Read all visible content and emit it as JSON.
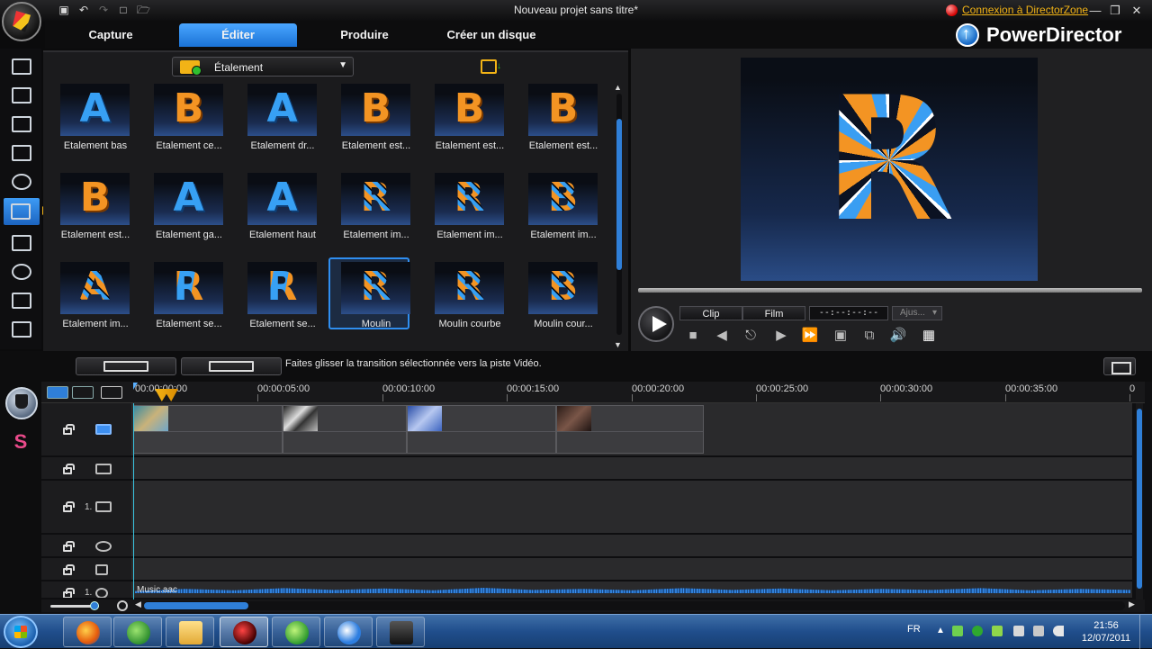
{
  "window": {
    "title": "Nouveau projet sans titre*",
    "director_zone_link": "Connexion à DirectorZone",
    "brand": "PowerDirector"
  },
  "tabs": [
    {
      "label": "Capture"
    },
    {
      "label": "Éditer"
    },
    {
      "label": "Produire"
    },
    {
      "label": "Créer un disque"
    }
  ],
  "library": {
    "category": "Étalement",
    "items": [
      {
        "label": "Etalement bas",
        "glyph": "A"
      },
      {
        "label": "Etalement ce...",
        "glyph": "B"
      },
      {
        "label": "Etalement dr...",
        "glyph": "A"
      },
      {
        "label": "Etalement est...",
        "glyph": "B"
      },
      {
        "label": "Etalement est...",
        "glyph": "B"
      },
      {
        "label": "Etalement est...",
        "glyph": "B"
      },
      {
        "label": "Etalement est...",
        "glyph": "B"
      },
      {
        "label": "Etalement ga...",
        "glyph": "A"
      },
      {
        "label": "Etalement haut",
        "glyph": "A"
      },
      {
        "label": "Etalement im...",
        "glyph": "R"
      },
      {
        "label": "Etalement im...",
        "glyph": "R"
      },
      {
        "label": "Etalement im...",
        "glyph": "B"
      },
      {
        "label": "Etalement im...",
        "glyph": "A"
      },
      {
        "label": "Etalement se...",
        "glyph": "R"
      },
      {
        "label": "Etalement se...",
        "glyph": "R"
      },
      {
        "label": "Moulin",
        "glyph": "R"
      },
      {
        "label": "Moulin courbe",
        "glyph": "R"
      },
      {
        "label": "Moulin cour...",
        "glyph": "B"
      }
    ],
    "selected_item": "Moulin"
  },
  "preview": {
    "mode_clip": "Clip",
    "mode_film": "Film",
    "timecode": "--:--:--:--",
    "fit_label": "Ajus...",
    "glyph": "R"
  },
  "midbar": {
    "hint": "Faites glisser la transition sélectionnée vers la piste Vidéo."
  },
  "timeline": {
    "ruler_labels": [
      "00:00:00:00",
      "00:00:05:00",
      "00:00:10:00",
      "00:00:15:00",
      "00:00:20:00",
      "00:00:25:00",
      "00:00:30:00",
      "00:00:35:00",
      "0"
    ],
    "track_numbers": {
      "pip": "1.",
      "music": "1."
    },
    "audio_clip_name": "Music.aac"
  },
  "taskbar": {
    "language": "FR",
    "time": "21:56",
    "date": "12/07/2011"
  },
  "colors": {
    "accent_blue": "#2f8ef0",
    "active_tab_top": "#4aa6ff",
    "link_yellow": "#f2b316",
    "orange_letter": "#f39423",
    "blue_letter": "#37a0f4"
  }
}
